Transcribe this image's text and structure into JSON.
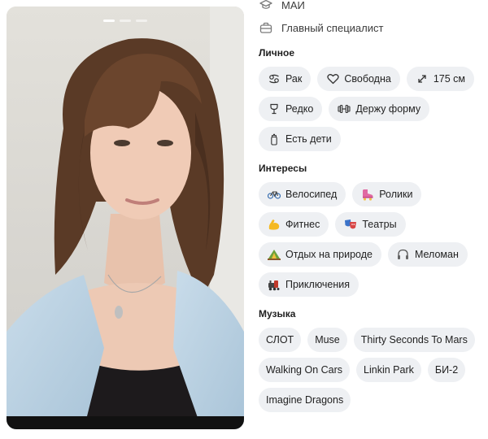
{
  "photo": {
    "stories_total": 3,
    "stories_active": 1
  },
  "meta": {
    "education": {
      "icon": "graduation-cap-icon",
      "text": "МАИ"
    },
    "job": {
      "icon": "briefcase-icon",
      "text": "Главный специалист"
    }
  },
  "personal": {
    "title": "Личное",
    "items": [
      {
        "icon": "zodiac-cancer-icon",
        "label": "Рак"
      },
      {
        "icon": "heart-icon",
        "label": "Свободна"
      },
      {
        "icon": "height-arrows-icon",
        "label": "175 см"
      },
      {
        "icon": "wine-glass-icon",
        "label": "Редко"
      },
      {
        "icon": "dumbbell-icon",
        "label": "Держу форму"
      },
      {
        "icon": "baby-bottle-icon",
        "label": "Есть дети"
      }
    ]
  },
  "interests": {
    "title": "Интересы",
    "items": [
      {
        "icon": "bicycle-icon",
        "label": "Велосипед"
      },
      {
        "icon": "roller-skate-icon",
        "label": "Ролики"
      },
      {
        "icon": "flexed-biceps-icon",
        "label": "Фитнес"
      },
      {
        "icon": "theater-masks-icon",
        "label": "Театры"
      },
      {
        "icon": "camping-icon",
        "label": "Отдых на природе"
      },
      {
        "icon": "headphones-icon",
        "label": "Меломан"
      },
      {
        "icon": "locomotive-icon",
        "label": "Приключения"
      }
    ]
  },
  "music": {
    "title": "Музыка",
    "items": [
      {
        "label": "СЛОТ"
      },
      {
        "label": "Muse"
      },
      {
        "label": "Thirty Seconds To Mars"
      },
      {
        "label": "Walking On Cars"
      },
      {
        "label": "Linkin Park"
      },
      {
        "label": "БИ-2"
      },
      {
        "label": "Imagine Dragons"
      }
    ]
  }
}
